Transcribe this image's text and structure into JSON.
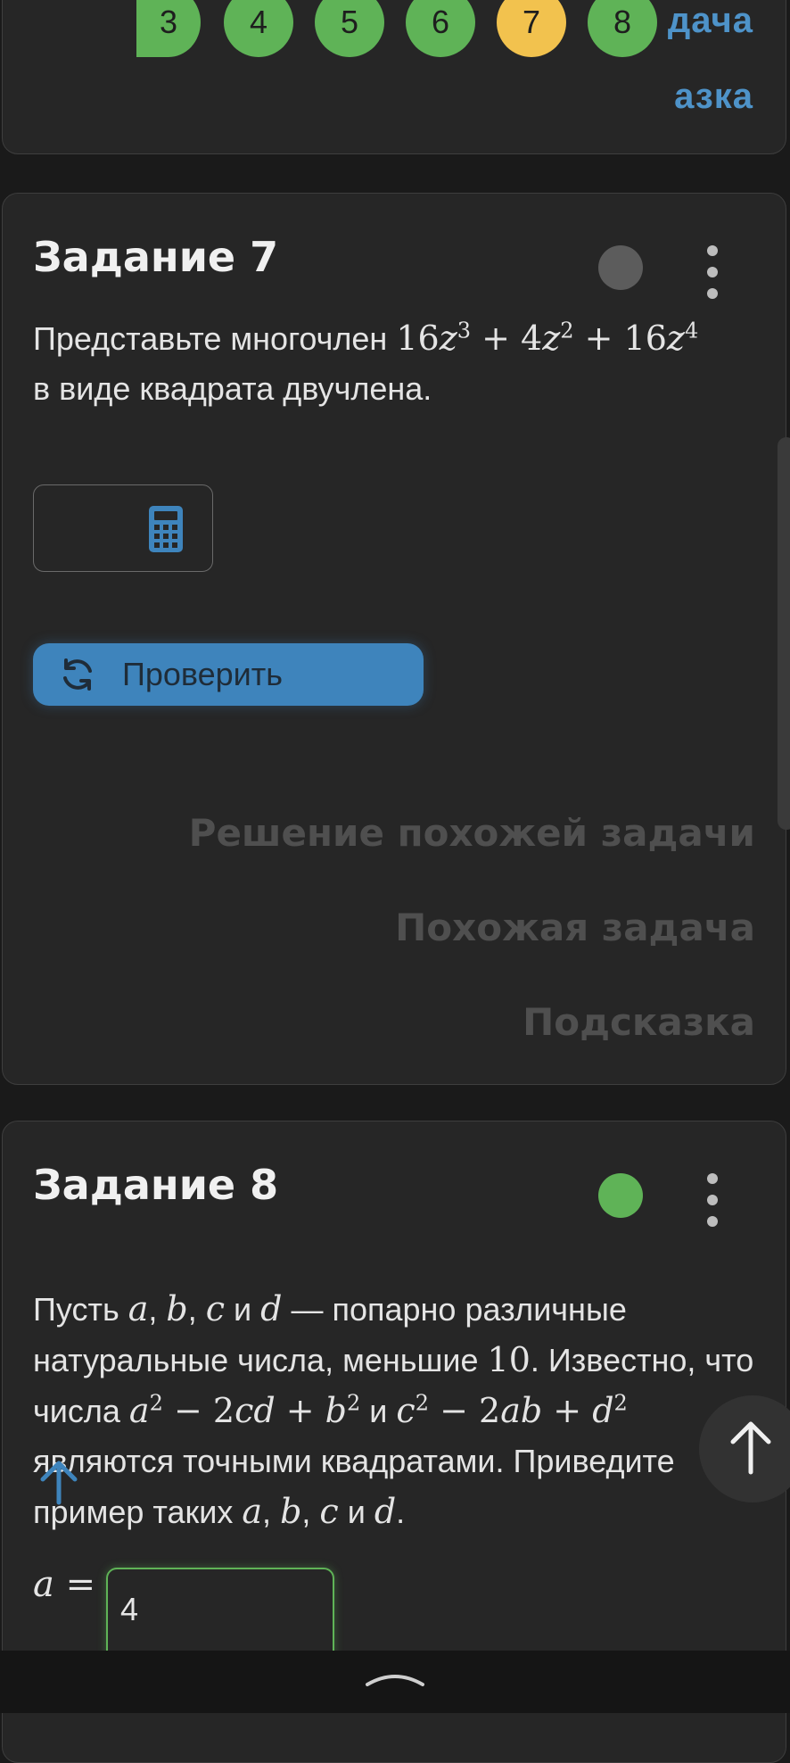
{
  "top_card": {
    "pages": [
      {
        "label": "3",
        "color": "#5fb357"
      },
      {
        "label": "4",
        "color": "#5fb357"
      },
      {
        "label": "5",
        "color": "#5fb357"
      },
      {
        "label": "6",
        "color": "#5fb357"
      },
      {
        "label": "7",
        "color": "#f2c24e"
      },
      {
        "label": "8",
        "color": "#5fb357"
      }
    ],
    "link_top": "дача",
    "link_bottom": "азка"
  },
  "task7": {
    "title": "Задание 7",
    "status_color": "#5c5c5c",
    "text_before": "Представьте многочлен",
    "text_after": "в виде квадрата двучлена.",
    "check_label": "Проверить",
    "links": [
      "Решение похожей задачи",
      "Похожая задача",
      "Подсказка"
    ]
  },
  "task8": {
    "title": "Задание 8",
    "status_color": "#5fb357",
    "answer_var": "a =",
    "answer_value": "4"
  },
  "colors": {
    "accent": "#3e84bc",
    "success": "#5fb357",
    "current": "#f2c24e"
  }
}
